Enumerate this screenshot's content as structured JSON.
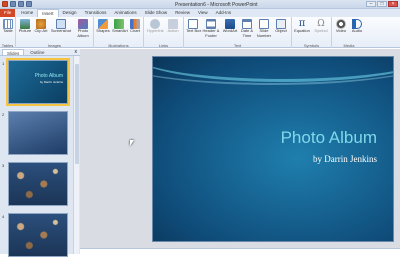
{
  "window": {
    "title": "Presentation6 - Microsoft PowerPoint",
    "min": "–",
    "max": "□",
    "close": "×"
  },
  "tabs": [
    "File",
    "Home",
    "Insert",
    "Design",
    "Transitions",
    "Animations",
    "Slide Show",
    "Review",
    "View",
    "Add-Ins"
  ],
  "active_tab": "Insert",
  "ribbon": {
    "groups": {
      "tables": "Tables",
      "images": "Images",
      "illustrations": "Illustrations",
      "links": "Links",
      "text": "Text",
      "symbols": "Symbols",
      "media": "Media"
    },
    "buttons": {
      "table": "Table",
      "picture": "Picture",
      "clip_art": "Clip Art",
      "screenshot": "Screenshot",
      "photo_album": "Photo Album",
      "shapes": "Shapes",
      "smartart": "SmartArt",
      "chart": "Chart",
      "hyperlink": "Hyperlink",
      "action": "Action",
      "text_box": "Text Box",
      "header_footer": "Header & Footer",
      "wordart": "WordArt",
      "date_time": "Date & Time",
      "slide_number": "Slide Number",
      "object": "Object",
      "equation": "Equation",
      "symbol": "Symbol",
      "video": "Video",
      "audio": "Audio"
    }
  },
  "panel": {
    "tab_slides": "Slides",
    "tab_outline": "Outline",
    "close": "x"
  },
  "thumbnails": {
    "n1": "1",
    "n2": "2",
    "n3": "3",
    "n4": "4",
    "t1_title": "Photo Album",
    "t1_sub": "by Darrin Jenkins"
  },
  "slide": {
    "title": "Photo Album",
    "subtitle": "by Darrin Jenkins"
  }
}
